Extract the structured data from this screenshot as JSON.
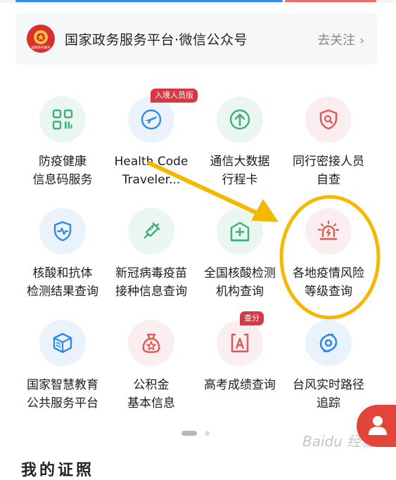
{
  "banner": {
    "logo_text": "国家政务服务",
    "title": "国家政务服务平台·微信公众号",
    "follow_label": "去关注"
  },
  "services": [
    {
      "label": "防疫健康\n信息码服务",
      "icon": "qr-code-icon",
      "color": "#3bb07a"
    },
    {
      "label": "Health Code\nTraveler...",
      "icon": "airplane-icon",
      "color": "#2f88e8",
      "badge": "入境人员版"
    },
    {
      "label": "通信大数据\n行程卡",
      "icon": "arrow-up-circle-icon",
      "color": "#3bb07a"
    },
    {
      "label": "同行密接人员\n自查",
      "icon": "shield-search-icon",
      "color": "#e0574f"
    },
    {
      "label": "核酸和抗体\n检测结果查询",
      "icon": "shield-pulse-icon",
      "color": "#2f88e8"
    },
    {
      "label": "新冠病毒疫苗\n接种信息查询",
      "icon": "syringe-icon",
      "color": "#3bb07a"
    },
    {
      "label": "全国核酸检测\n机构查询",
      "icon": "hospital-icon",
      "color": "#3bb07a"
    },
    {
      "label": "各地疫情风险\n等级查询",
      "icon": "alarm-light-icon",
      "color": "#e0574f"
    },
    {
      "label": "国家智慧教育\n公共服务平台",
      "icon": "book-cube-icon",
      "color": "#2f88e8"
    },
    {
      "label": "公积金\n基本信息",
      "icon": "money-bag-icon",
      "color": "#e0574f"
    },
    {
      "label": "高考成绩查询",
      "icon": "grade-card-icon",
      "color": "#e0574f",
      "badge": "查分"
    },
    {
      "label": "台风实时路径\n追踪",
      "icon": "typhoon-icon",
      "color": "#2f88e8"
    }
  ],
  "pagination": {
    "current": 1,
    "total": 2
  },
  "annotation": {
    "arrow_color": "#f5b800",
    "circle_color": "#f5b800"
  },
  "watermark": "Baidu 经验",
  "bottom_partial_text": "我的证照"
}
